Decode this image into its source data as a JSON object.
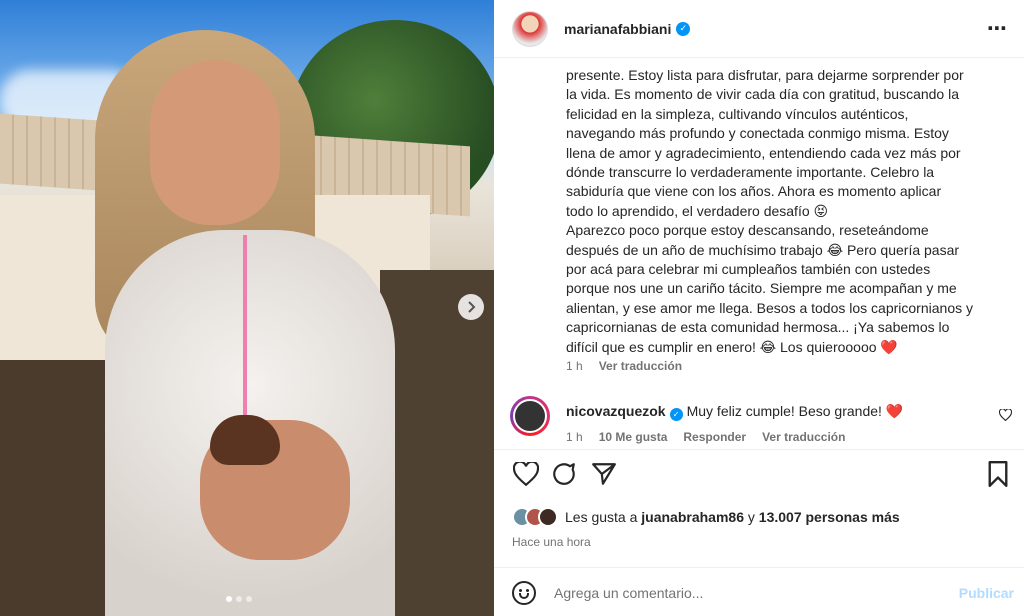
{
  "post": {
    "username": "marianafabbiani",
    "more_icon": "more-horizontal-icon",
    "carousel_dots": 3,
    "carousel_active": 0
  },
  "caption": {
    "text": "presente. Estoy lista para disfrutar, para dejarme sorprender por\nla vida. Es momento de vivir cada día con gratitud, buscando la\nfelicidad en la simpleza, cultivando vínculos auténticos,\nnavegando más profundo y conectada conmigo misma. Estoy\nllena de amor y agradecimiento, entendiendo cada vez más por\ndónde transcurre lo verdaderamente importante. Celebro la\nsabiduría que viene con los años. Ahora es momento aplicar\ntodo lo aprendido, el verdadero desafío 😝\nAparezco poco porque estoy descansando, reseteándome\ndespués de un año de muchísimo trabajo 😂 Pero quería pasar\npor acá para celebrar mi cumpleaños también con ustedes\nporque nos une un cariño tácito. Siempre me acompañan y me\nalientan, y ese amor me llega. Besos a todos los capricornianos y\ncapricornianas de esta comunidad hermosa... ¡Ya sabemos lo\ndifícil que es cumplir en enero! 😂 Los quierooooo ❤️",
    "time": "1 h",
    "translate": "Ver traducción"
  },
  "comment": {
    "username": "nicovazquezok",
    "text": "Muy feliz cumple! Beso grande!",
    "heart": "❤️",
    "time": "1 h",
    "likes": "10 Me gusta",
    "reply": "Responder",
    "translate": "Ver traducción"
  },
  "likes": {
    "prefix": "Les gusta a",
    "user": "juanabraham86",
    "connector": "y",
    "count": "13.007 personas más"
  },
  "timestamp": "Hace una hora",
  "comment_box": {
    "placeholder": "Agrega un comentario...",
    "publish": "Publicar"
  }
}
